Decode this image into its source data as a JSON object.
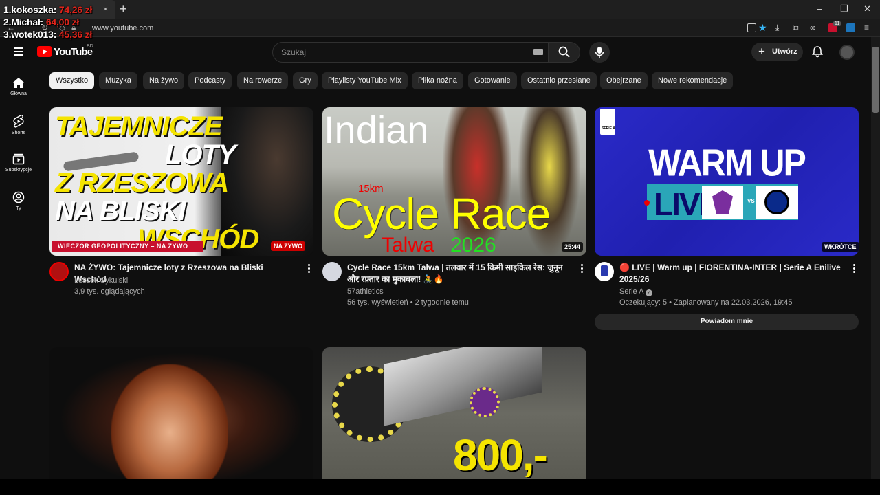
{
  "browser": {
    "tab_close": "×",
    "new_tab": "+",
    "url": "www.youtube.com",
    "window_controls": [
      "–",
      "❐",
      "✕"
    ],
    "extension_badge": "11"
  },
  "overlay": {
    "ranking": [
      {
        "label": "1.kokoszka:",
        "amount": "74,26 zł"
      },
      {
        "label": "2.Michał:",
        "amount": "64,00 zł"
      },
      {
        "label": "3.wotek013:",
        "amount": "45,36 zł"
      }
    ]
  },
  "header": {
    "logo_text": "YouTube",
    "country_code": "BD",
    "search_placeholder": "Szukaj",
    "create_label": "Utwórz",
    "create_icon": "plus-icon"
  },
  "sidebar": {
    "items": [
      {
        "label": "Główna",
        "icon": "home-icon"
      },
      {
        "label": "Shorts",
        "icon": "shorts-icon"
      },
      {
        "label": "Subskrypcje",
        "icon": "subscriptions-icon"
      },
      {
        "label": "Ty",
        "icon": "user-icon"
      }
    ]
  },
  "chips": [
    "Wszystko",
    "Muzyka",
    "Na żywo",
    "Podcasty",
    "Na rowerze",
    "Gry",
    "Playlisty YouTube Mix",
    "Piłka nożna",
    "Gotowanie",
    "Ostatnio przesłane",
    "Obejrzane",
    "Nowe rekomendacje"
  ],
  "videos": [
    {
      "thumb_lines": [
        "TAJEMNICZE",
        "LOTY",
        "Z RZESZOWA",
        "NA BLISKI",
        "WSCHÓD"
      ],
      "thumb_banner": "WIECZÓR GEOPOLITYCZNY – NA ŻYWO",
      "badge": "NA ŻYWO",
      "title": "NA ŻYWO: Tajemnicze loty z Rzeszowa na Bliski Wschód",
      "channel": "Leszek Sykulski",
      "stats": "3,9 tys. oglądających"
    },
    {
      "thumb_lines": [
        "Indian",
        "15km",
        "Cycle Race",
        "Talwa",
        "2026"
      ],
      "badge": "25:44",
      "title": "Cycle Race 15km Talwa | तलवार में 15 किमी साइकिल रेस: जुनून और रफ़्तार का मुकाबला! 🚴🔥",
      "channel": "57athletics",
      "stats": "56 tys. wyświetleń • 2 tygodnie temu"
    },
    {
      "thumb_lines": [
        "WARM UP",
        "LIVE",
        "VS",
        "SERIE A"
      ],
      "badge": "WKRÓTCE",
      "title": "🔴 LIVE | Warm up | FIORENTINA-INTER | Serie A Enilive 2025/26",
      "channel": "Serie A",
      "stats": "Oczekujący: 5 • Zaplanowany na 22.03.2026, 19:45",
      "notify_label": "Powiadom mnie"
    },
    {
      "thumb_lines": []
    },
    {
      "thumb_lines": [
        "800,-"
      ]
    }
  ],
  "colors": {
    "background": "#0f0f0f",
    "brand_red": "#ff0000",
    "thumb1_yellow": "#f5e400",
    "thumb3_blue": "#2323b8"
  }
}
